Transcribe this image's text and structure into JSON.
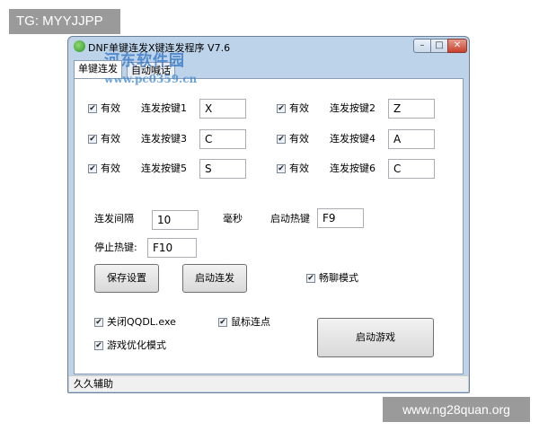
{
  "watermarks": {
    "tg": "TG: MYYJJPP",
    "site": "www.ng28quan.org",
    "overlay_site": "河东软件园",
    "overlay_url": "www.pc0359.cn"
  },
  "window": {
    "title": "DNF单键连发X键连发程序  V7.6",
    "controls": {
      "minimize": "–",
      "maximize": "□",
      "close": "✕"
    }
  },
  "tabs": [
    {
      "label": "单键连发",
      "active": true
    },
    {
      "label": "自动喊话",
      "active": false
    }
  ],
  "keys": [
    {
      "enabled_label": "有效",
      "checked": true,
      "name": "连发按键1",
      "value": "X"
    },
    {
      "enabled_label": "有效",
      "checked": true,
      "name": "连发按键2",
      "value": "Z"
    },
    {
      "enabled_label": "有效",
      "checked": true,
      "name": "连发按键3",
      "value": "C"
    },
    {
      "enabled_label": "有效",
      "checked": true,
      "name": "连发按键4",
      "value": "A"
    },
    {
      "enabled_label": "有效",
      "checked": true,
      "name": "连发按键5",
      "value": "S"
    },
    {
      "enabled_label": "有效",
      "checked": true,
      "name": "连发按键6",
      "value": "C"
    }
  ],
  "interval": {
    "label": "连发间隔",
    "value": "10",
    "unit": "毫秒"
  },
  "start_hotkey": {
    "label": "启动热键",
    "value": "F9"
  },
  "stop_hotkey": {
    "label": "停止热键:",
    "value": "F10"
  },
  "buttons": {
    "save": "保存设置",
    "start_fire": "启动连发",
    "start_game": "启动游戏"
  },
  "options": {
    "chat_mode": {
      "label": "畅聊模式",
      "checked": true
    },
    "close_qqdl": {
      "label": "关闭QQDL.exe",
      "checked": true
    },
    "mouse_click": {
      "label": "鼠标连点",
      "checked": true
    },
    "game_optimize": {
      "label": "游戏优化模式",
      "checked": true
    }
  },
  "status": "久久辅助",
  "check_glyph": "✔"
}
